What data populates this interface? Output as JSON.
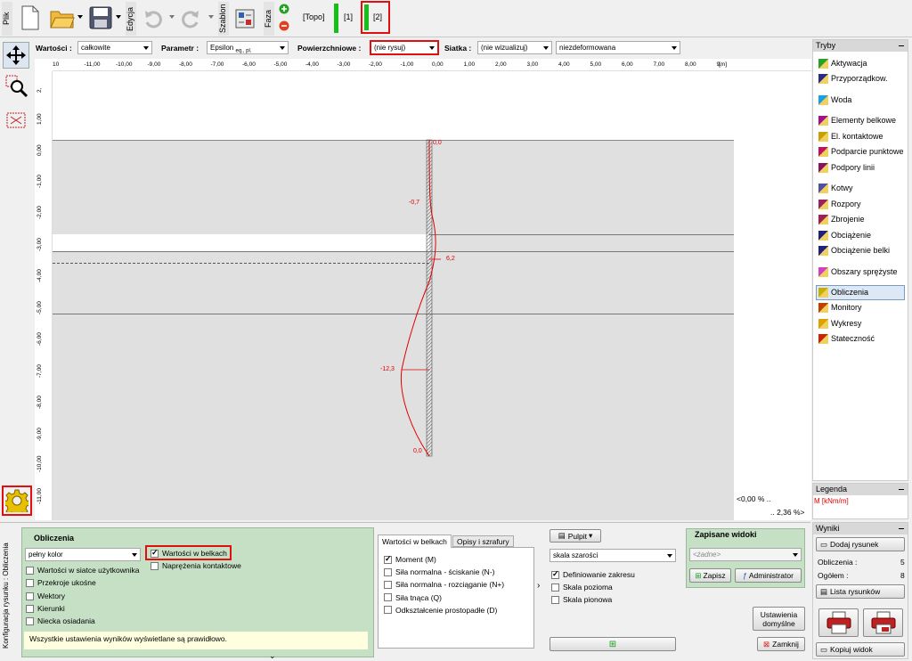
{
  "toolbar": {
    "plik": "Plik",
    "edycja": "Edycja",
    "szablon": "Szablon",
    "faza": "Faza",
    "phase_topo": "[Topo]",
    "phase_1": "[1]",
    "phase_2": "[2]"
  },
  "filters": {
    "wartosci_label": "Wartości :",
    "wartosci_value": "całkowite",
    "parametr_label": "Parametr :",
    "parametr_value": "Epsilon",
    "parametr_sub": "eq., pl.",
    "powierzchniowe_label": "Powierzchniowe :",
    "powierzchniowe_value": "(nie rysuj)",
    "siatka_label": "Siatka :",
    "siatka_value": "(nie wizualizuj)",
    "deform_value": "niezdeformowana"
  },
  "ruler": {
    "unit": "[m]",
    "x_ticks": [
      "10",
      "-11,00",
      "-10,00",
      "-9,00",
      "-8,00",
      "-7,00",
      "-6,00",
      "-5,00",
      "-4,00",
      "-3,00",
      "-2,00",
      "-1,00",
      "0,00",
      "1,00",
      "2,00",
      "3,00",
      "4,00",
      "5,00",
      "6,00",
      "7,00",
      "8,00",
      "9,"
    ],
    "y_ticks": [
      "2,",
      "1,00",
      "0,00",
      "-1,00",
      "-2,00",
      "-3,00",
      "-4,00",
      "-5,00",
      "-6,00",
      "-7,00",
      "-8,00",
      "-9,00",
      "-10,00",
      "-11,00"
    ]
  },
  "diagram": {
    "labels": [
      "0,0",
      "-0,7",
      "6,2",
      "-12,3",
      "0,0"
    ],
    "zoom1": "<0,00 % ..",
    "zoom2": ".. 2,36 %>"
  },
  "modes": {
    "title": "Tryby",
    "items": [
      "Aktywacja",
      "Przyporządkow.",
      "Woda",
      "Elementy belkowe",
      "El. kontaktowe",
      "Podparcie punktowe",
      "Podpory linii",
      "Kotwy",
      "Rozpory",
      "Zbrojenie",
      "Obciążenie",
      "Obciążenie belki",
      "Obszary sprężyste",
      "Obliczenia",
      "Monitory",
      "Wykresy",
      "Stateczność"
    ],
    "colors": [
      "#2aa02a",
      "#2a2a8a",
      "#18a0e0",
      "#a01090",
      "#c8a000",
      "#c01060",
      "#8a1060",
      "#5050a0",
      "#9a2060",
      "#a02050",
      "#202080",
      "#202080",
      "#d040c0",
      "#c8b000",
      "#c04000",
      "#e0a000",
      "#d02000"
    ]
  },
  "legend": {
    "title": "Legenda",
    "entry": "M [kNm/m]"
  },
  "results": {
    "title": "Wyniki",
    "add_button": "Dodaj rysunek",
    "obliczenia_label": "Obliczenia :",
    "obliczenia_value": "5",
    "ogolem_label": "Ogółem :",
    "ogolem_value": "8",
    "list_button": "Lista rysunków",
    "copy_button": "Kopiuj widok"
  },
  "bottom": {
    "side_label": "Konfiguracja rysunku : Obliczenia",
    "section_title": "Obliczenia",
    "color_mode": "pełny kolor",
    "cb_beam_values": "Wartości w belkach",
    "cb_contact_stress": "Naprężenia kontaktowe",
    "cb_grid_values": "Wartości w siatce użytkownika",
    "cb_skew": "Przekroje ukośne",
    "cb_vectors": "Wektory",
    "cb_directions": "Kierunki",
    "cb_settlement": "Niecka osiadania",
    "status": "Wszystkie ustawienia wyników wyświetlane są prawidłowo.",
    "tab1": "Wartości w belkach",
    "tab2": "Opisy i szrafury",
    "beam_items": [
      "Moment (M)",
      "Siła normalna - ściskanie (N-)",
      "Siła normalna - rozciąganie (N+)",
      "Siła tnąca (Q)",
      "Odkształcenie prostopadłe (D)"
    ],
    "pulpit": "Pulpit",
    "scale_value": "skala szarości",
    "cb_range": "Definiowanie zakresu",
    "cb_hscale": "Skala pozioma",
    "cb_vscale": "Skala pionowa",
    "saved_title": "Zapisane widoki",
    "saved_placeholder": "<żadne>",
    "save_btn": "Zapisz",
    "admin_btn": "Administrator",
    "default_btn_1": "Ustawienia",
    "default_btn_2": "domyślne",
    "close_btn": "Zamknij"
  }
}
